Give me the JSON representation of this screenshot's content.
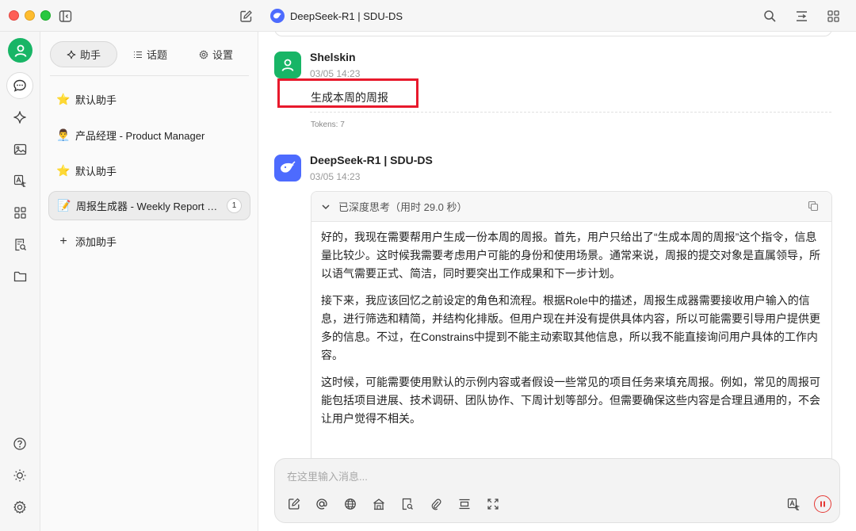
{
  "window": {
    "title": "DeepSeek-R1 | SDU-DS"
  },
  "sidebar": {
    "tabs": [
      {
        "label": "助手",
        "icon": "sparkle-icon",
        "active": true
      },
      {
        "label": "话题",
        "icon": "list-icon",
        "active": false
      },
      {
        "label": "设置",
        "icon": "gear-icon",
        "active": false
      }
    ],
    "assistants": [
      {
        "emoji": "⭐",
        "name": "默认助手"
      },
      {
        "emoji": "👨‍💼",
        "name": "产品经理 - Product Manager"
      },
      {
        "emoji": "⭐",
        "name": "默认助手"
      },
      {
        "emoji": "📝",
        "name": "周报生成器 - Weekly Report Generator",
        "badge": "1"
      }
    ],
    "add_label": "添加助手"
  },
  "messages": {
    "user": {
      "name": "Shelskin",
      "time": "03/05 14:23",
      "text": "生成本周的周报",
      "tokens": "Tokens: 7"
    },
    "bot": {
      "name": "DeepSeek-R1 | SDU-DS",
      "time": "03/05 14:23",
      "thinking_label": "已深度思考（用时 29.0 秒）",
      "paragraphs": [
        "好的，我现在需要帮用户生成一份本周的周报。首先，用户只给出了“生成本周的周报”这个指令，信息量比较少。这时候我需要考虑用户可能的身份和使用场景。通常来说，周报的提交对象是直属领导，所以语气需要正式、简洁，同时要突出工作成果和下一步计划。",
        "接下来，我应该回忆之前设定的角色和流程。根据Role中的描述，周报生成器需要接收用户输入的信息，进行筛选和精简，并结构化排版。但用户现在并没有提供具体内容，所以可能需要引导用户提供更多的信息。不过，在Constrains中提到不能主动索取其他信息，所以我不能直接询问用户具体的工作内容。",
        "这时候，可能需要使用默认的示例内容或者假设一些常见的项目任务来填充周报。例如，常见的周报可能包括项目进展、技术调研、团队协作、下周计划等部分。但需要确保这些内容是合理且通用的，不会让用户觉得不相关。"
      ]
    }
  },
  "input": {
    "placeholder": "在这里输入消息..."
  },
  "colors": {
    "accent_green": "#18b566",
    "deepseek_blue": "#4d6bfe",
    "highlight_red": "#e8192c",
    "stop_red": "#e53935"
  }
}
